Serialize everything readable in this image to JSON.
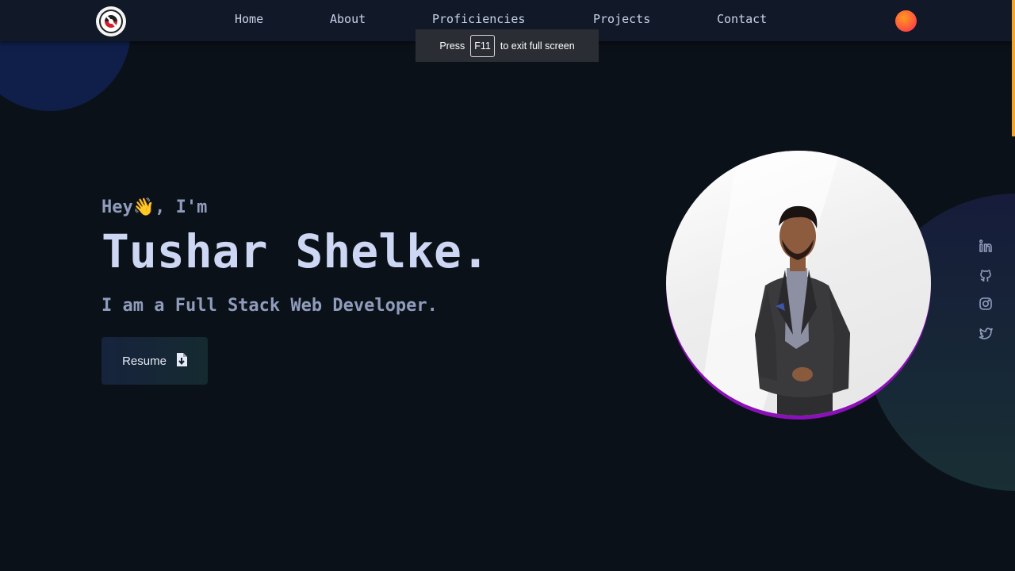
{
  "nav": {
    "links": [
      {
        "label": "Home"
      },
      {
        "label": "About"
      },
      {
        "label": "Proficiencies"
      },
      {
        "label": "Projects"
      },
      {
        "label": "Contact"
      }
    ]
  },
  "fullscreen_toast": {
    "prefix": "Press",
    "key": "F11",
    "suffix": "to exit full screen"
  },
  "hero": {
    "greeting_start": "Hey",
    "wave_emoji": "👋",
    "greeting_end": ", I'm",
    "name": "Tushar Shelke.",
    "role": "I am a Full Stack Web Developer.",
    "resume_label": "Resume"
  },
  "icons": {
    "logo": "logo-icon",
    "theme_toggle": "theme-toggle-icon",
    "resume": "file-download-icon",
    "social": [
      "linkedin-icon",
      "github-icon",
      "instagram-icon",
      "twitter-icon"
    ]
  },
  "colors": {
    "background": "#0b1118",
    "navbar": "#111827",
    "name_text": "#cdd7f4",
    "muted_text": "#8f9cbc",
    "profile_ring": "#8b10b8",
    "scroll_indicator": "#f4a62a"
  }
}
